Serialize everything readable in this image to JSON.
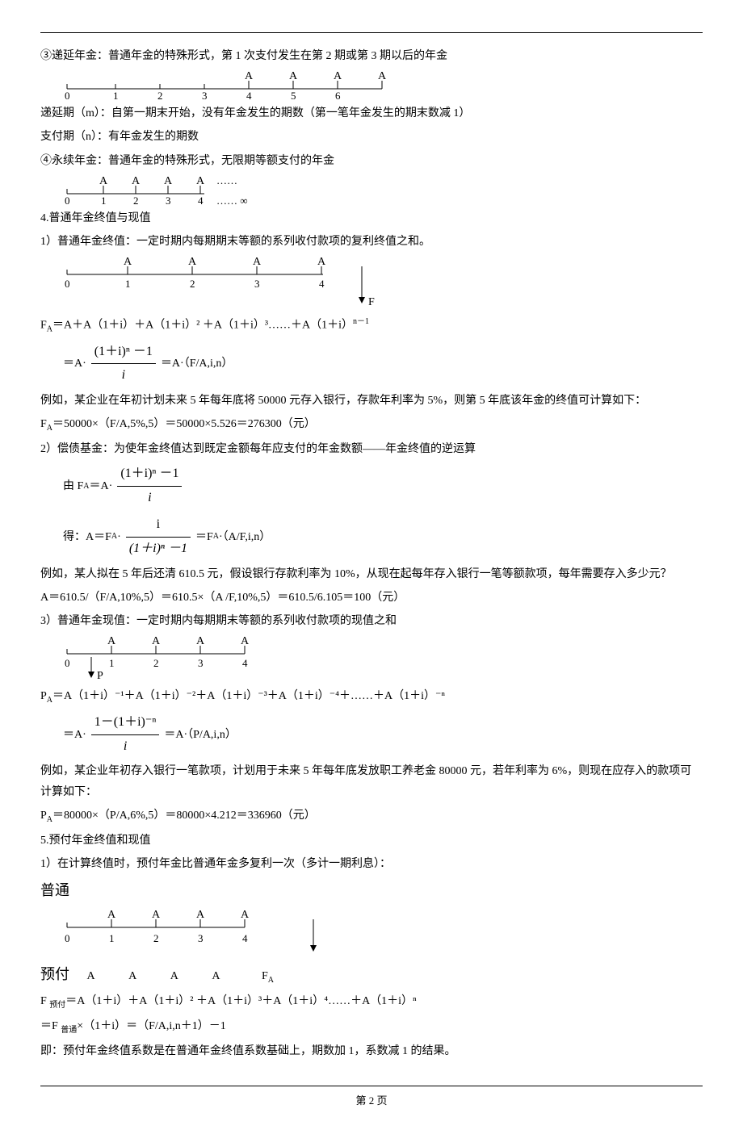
{
  "p1": "③递延年金：普通年金的特殊形式，第 1 次支付发生在第 2 期或第 3 期以后的年金",
  "p2": "递延期（m）：自第一期末开始，没有年金发生的期数（第一笔年金发生的期末数减 1）",
  "p3": "支付期（n）：有年金发生的期数",
  "p4": "④永续年金：普通年金的特殊形式，无限期等额支付的年金",
  "p5": "4.普通年金终值与现值",
  "p6": "1）普通年金终值：一定时期内每期期末等额的系列收付款项的复利终值之和。",
  "p7_pre": "F",
  "p7_sub": "A",
  "p7_rest": "＝A＋A（1＋i）＋A（1＋i）² ＋A（1＋i）³……＋A（1＋i）",
  "p7_sup": "n－1",
  "p8_pre": "＝A·",
  "p8_post": "＝A·（F/A,i,n）",
  "p9": "例如，某企业在年初计划未来 5 年每年底将 50000 元存入银行，存款年利率为 5%，则第 5 年底该年金的终值可计算如下：",
  "p10_pre": "F",
  "p10_sub": "A",
  "p10_rest": "＝50000×（F/A,5%,5）＝50000×5.526＝276300（元）",
  "p11": "2）偿债基金：为使年金终值达到既定金额每年应支付的年金数额——年金终值的逆运算",
  "p12_pre": "由 F",
  "p12_sub": "A",
  "p12_post": "＝A·",
  "p13_pre": "得：A＝F",
  "p13_sub1": "A",
  "p13_mid": "·",
  "p13_after": "＝F",
  "p13_sub2": "A",
  "p13_end": "·（A/F,i,n）",
  "p14": "例如，某人拟在 5 年后还清 610.5 元，假设银行存款利率为 10%，从现在起每年存入银行一笔等额款项，每年需要存入多少元？",
  "p15": "A＝610.5/（F/A,10%,5）＝610.5×（A /F,10%,5）＝610.5/6.105＝100（元）",
  "p16": "3）普通年金现值：一定时期内每期期末等额的系列收付款项的现值之和",
  "p17_pre": "P",
  "p17_sub": "A",
  "p17_rest": "＝A（1＋i）⁻¹＋A（1＋i）⁻²＋A（1＋i）⁻³＋A（1＋i）⁻⁴＋……＋A（1＋i）⁻ⁿ",
  "p18_pre": "＝A·",
  "p18_post": "＝A·（P/A,i,n）",
  "p19": "例如，某企业年初存入银行一笔款项，计划用于未来 5 年每年底发放职工养老金 80000 元，若年利率为 6%，则现在应存入的款项可计算如下：",
  "p20_pre": "P",
  "p20_sub": "A",
  "p20_rest": "＝80000×（P/A,6%,5）＝80000×4.212＝336960（元）",
  "p21": "5.预付年金终值和现值",
  "p22": "1）在计算终值时，预付年金比普通年金多复利一次（多计一期利息）：",
  "p23": "普通",
  "p24": "预付",
  "p24_fa": "F",
  "p24_fa_sub": "A",
  "p25_pre": "F ",
  "p25_sub": "预付",
  "p25_rest": "＝A（1＋i）＋A（1＋i）² ＋A（1＋i）³＋A（1＋i）⁴……＋A（1＋i）ⁿ",
  "p26_pre": "＝F ",
  "p26_sub": "普通",
  "p26_rest": "×（1＋i）＝（F/A,i,n＋1）－1",
  "p27": "即：预付年金终值系数是在普通年金终值系数基础上，期数加 1，系数减 1 的结果。",
  "footer": "第 2 页",
  "frac1_num": "(1＋i)ⁿ －1",
  "frac1_den": "i",
  "frac2_num": "(1＋i)ⁿ －1",
  "frac2_den": "i",
  "frac3_num": "i",
  "frac3_den": "(1＋i)ⁿ －1",
  "frac4_num": "1－(1＋i)⁻ⁿ",
  "frac4_den": "i"
}
